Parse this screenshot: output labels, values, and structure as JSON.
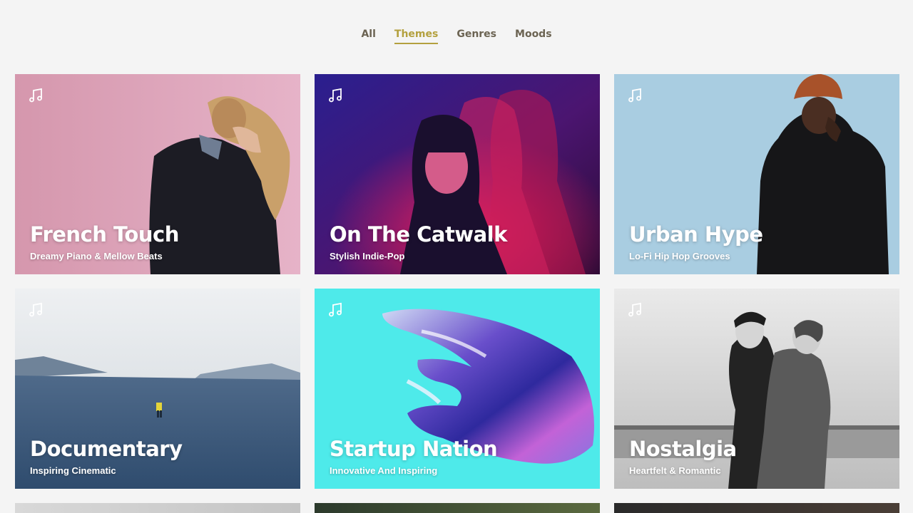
{
  "tabs": [
    {
      "label": "All",
      "active": false
    },
    {
      "label": "Themes",
      "active": true
    },
    {
      "label": "Genres",
      "active": false
    },
    {
      "label": "Moods",
      "active": false
    }
  ],
  "cards": [
    {
      "title": "French Touch",
      "subtitle": "Dreamy Piano & Mellow Beats",
      "icon": "music-note-icon"
    },
    {
      "title": "On The Catwalk",
      "subtitle": "Stylish Indie-Pop",
      "icon": "music-note-icon"
    },
    {
      "title": "Urban Hype",
      "subtitle": "Lo-Fi Hip Hop Grooves",
      "icon": "music-note-icon"
    },
    {
      "title": "Documentary",
      "subtitle": "Inspiring Cinematic",
      "icon": "music-note-icon"
    },
    {
      "title": "Startup Nation",
      "subtitle": "Innovative And Inspiring",
      "icon": "music-note-icon"
    },
    {
      "title": "Nostalgia",
      "subtitle": "Heartfelt & Romantic",
      "icon": "music-note-icon"
    }
  ],
  "colors": {
    "background": "#f4f4f4",
    "tab_text": "#6b6352",
    "tab_active": "#b3a03e"
  }
}
